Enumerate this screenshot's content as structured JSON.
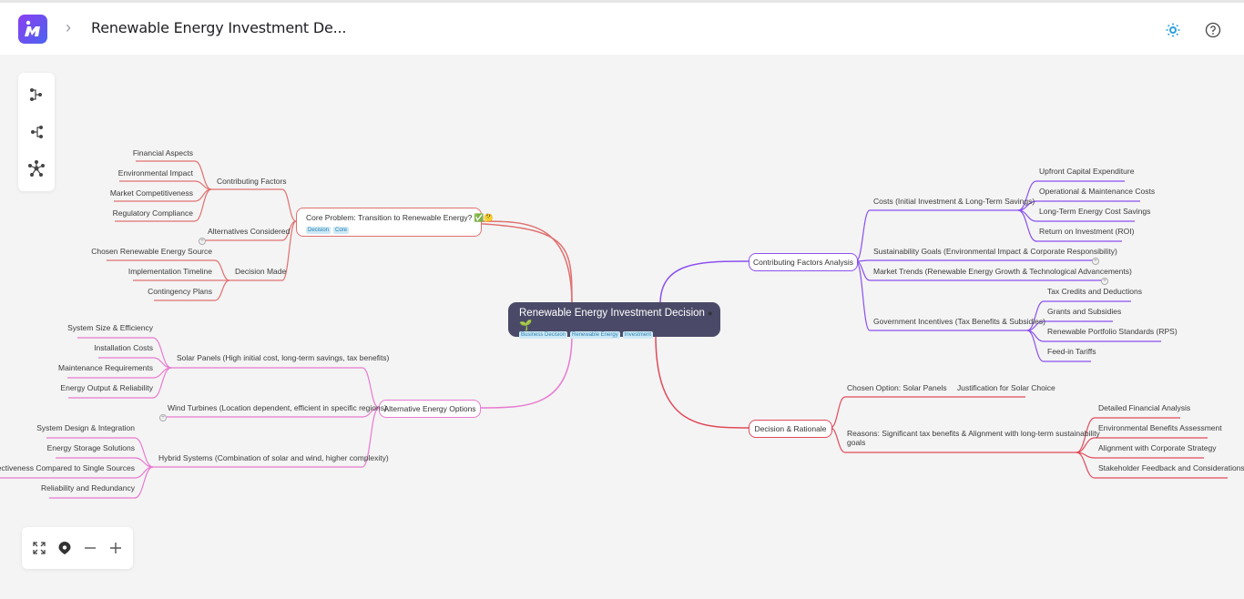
{
  "header": {
    "title": "Renewable Energy Investment De...",
    "breadcrumb_separator": "›",
    "icons": [
      "app-logo",
      "theme-toggle-icon",
      "help-icon"
    ]
  },
  "toolbar": {
    "tools": [
      "layout-right-icon",
      "layout-left-icon",
      "layout-radial-icon"
    ]
  },
  "zoom_controls": {
    "tools": [
      "fit-view-icon",
      "locate-icon",
      "zoom-out-icon",
      "zoom-in-icon"
    ]
  },
  "colors": {
    "root_bg": "#4a4a68",
    "branch_core": "#e07070",
    "branch_alternatives": "#e87ad0",
    "branch_factors": "#8a4ff0",
    "branch_decision": "#e04a5a",
    "tag_bg": "#cde9f6"
  },
  "mindmap": {
    "root": {
      "label": "Renewable Energy Investment Decision",
      "emoji": "🌱",
      "tags": [
        "Business Decision",
        "Renewable Energy",
        "Investment"
      ]
    },
    "core": {
      "label": "Core Problem: Transition to Renewable Energy?",
      "emoji": "✅🤔",
      "tags": [
        "Decision",
        "Core"
      ],
      "children": [
        {
          "label": "Contributing Factors",
          "children": [
            "Financial Aspects",
            "Environmental Impact",
            "Market Competitiveness",
            "Regulatory Compliance"
          ]
        },
        {
          "label": "Alternatives Considered",
          "collapsed": true
        },
        {
          "label": "Decision Made",
          "children": [
            "Chosen Renewable Energy Source",
            "Implementation Timeline",
            "Contingency Plans"
          ]
        }
      ]
    },
    "alternatives": {
      "label": "Alternative Energy Options",
      "children": [
        {
          "label": "Solar Panels (High initial cost, long-term savings, tax benefits)",
          "children": [
            "System Size & Efficiency",
            "Installation Costs",
            "Maintenance Requirements",
            "Energy Output & Reliability"
          ]
        },
        {
          "label": "Wind Turbines (Location dependent, efficient in specific regions)",
          "collapsed": true
        },
        {
          "label": "Hybrid Systems (Combination of solar and wind, higher complexity)",
          "children": [
            "System Design & Integration",
            "Energy Storage Solutions",
            "Cost-Effectiveness Compared to Single Sources",
            "Reliability and Redundancy"
          ]
        }
      ]
    },
    "factors": {
      "label": "Contributing Factors Analysis",
      "children": [
        {
          "label": "Costs (Initial Investment & Long-Term Savings)",
          "children": [
            "Upfront Capital Expenditure",
            "Operational & Maintenance Costs",
            "Long-Term Energy Cost Savings",
            "Return on Investment (ROI)"
          ]
        },
        {
          "label": "Sustainability Goals (Environmental Impact & Corporate Responsibility)",
          "collapsed": true
        },
        {
          "label": "Market Trends (Renewable Energy Growth & Technological Advancements)",
          "collapsed": true
        },
        {
          "label": "Government Incentives (Tax Benefits & Subsidies)",
          "children": [
            "Tax Credits and Deductions",
            "Grants and Subsidies",
            "Renewable Portfolio Standards (RPS)",
            "Feed-in Tariffs"
          ]
        }
      ]
    },
    "decision": {
      "label": "Decision & Rationale",
      "children": [
        {
          "label": "Chosen Option: Solar Panels",
          "children": [
            "Justification for Solar Choice"
          ]
        },
        {
          "label": "Reasons: Significant tax benefits & Alignment with long-term sustainability",
          "label_line2": "goals",
          "children": [
            "Detailed Financial Analysis",
            "Environmental Benefits Assessment",
            "Alignment with Corporate Strategy",
            "Stakeholder Feedback and Considerations"
          ]
        }
      ]
    }
  }
}
